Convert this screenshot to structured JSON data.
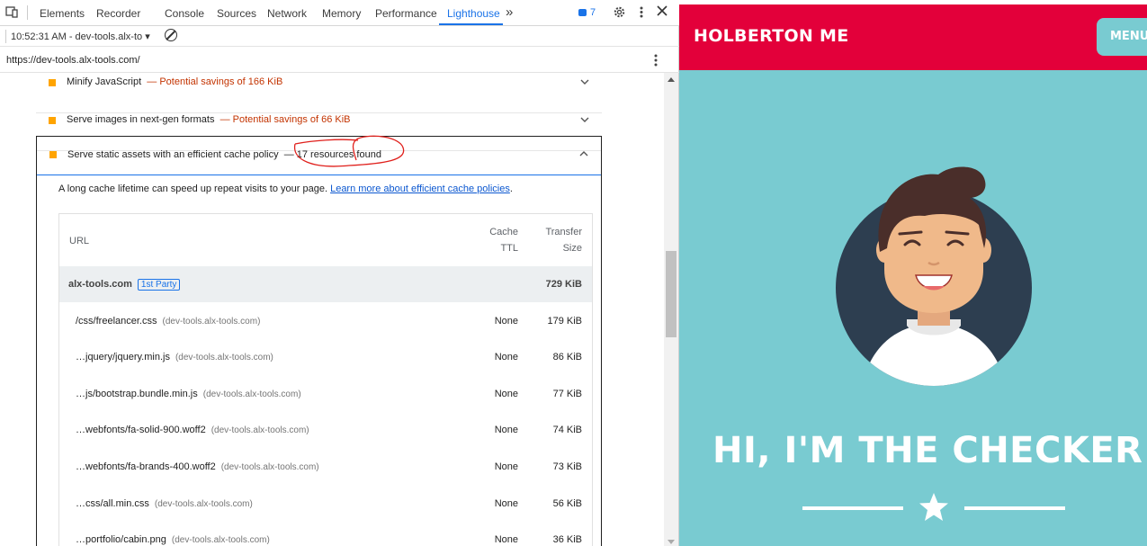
{
  "devtools": {
    "tabs": [
      "Elements",
      "Recorder",
      "Console",
      "Sources",
      "Network",
      "Memory",
      "Performance",
      "Lighthouse"
    ],
    "active_tab": "Lighthouse",
    "more_tabs": "»",
    "issues_count": "7",
    "report_selector": "10:52:31 AM - dev-tools.alx-to ▾",
    "page_url": "https://dev-tools.alx-tools.com/"
  },
  "audits": [
    {
      "title": "Minify JavaScript",
      "dash": "—",
      "detail": "Potential savings of 166 KiB"
    },
    {
      "title": "Serve images in next-gen formats",
      "dash": "—",
      "detail": "Potential savings of 66 KiB"
    }
  ],
  "expanded_audit": {
    "title": "Serve static assets with an efficient cache policy",
    "dash": "—",
    "detail": "17 resources found",
    "description": "A long cache lifetime can speed up repeat visits to your page.",
    "learn_more": "Learn more about efficient cache policies",
    "learn_more_suffix": ".",
    "table": {
      "col_url": "URL",
      "col_ttl_1": "Cache",
      "col_ttl_2": "TTL",
      "col_size_1": "Transfer",
      "col_size_2": "Size",
      "group": {
        "host": "alx-tools.com",
        "badge": "1st Party",
        "size": "729 KiB"
      },
      "rows": [
        {
          "url": "/css/freelancer.css",
          "host": "(dev-tools.alx-tools.com)",
          "ttl": "None",
          "size": "179 KiB"
        },
        {
          "url": "…jquery/jquery.min.js",
          "host": "(dev-tools.alx-tools.com)",
          "ttl": "None",
          "size": "86 KiB"
        },
        {
          "url": "…js/bootstrap.bundle.min.js",
          "host": "(dev-tools.alx-tools.com)",
          "ttl": "None",
          "size": "77 KiB"
        },
        {
          "url": "…webfonts/fa-solid-900.woff2",
          "host": "(dev-tools.alx-tools.com)",
          "ttl": "None",
          "size": "74 KiB"
        },
        {
          "url": "…webfonts/fa-brands-400.woff2",
          "host": "(dev-tools.alx-tools.com)",
          "ttl": "None",
          "size": "73 KiB"
        },
        {
          "url": "…css/all.min.css",
          "host": "(dev-tools.alx-tools.com)",
          "ttl": "None",
          "size": "56 KiB"
        },
        {
          "url": "…portfolio/cabin.png",
          "host": "(dev-tools.alx-tools.com)",
          "ttl": "None",
          "size": "36 KiB"
        }
      ]
    }
  },
  "site": {
    "brand": "HOLBERTON ME",
    "menu_label": "MENU",
    "hero_heading": "HI, I'M THE CHECKER!",
    "colors": {
      "nav": "#e3003a",
      "background": "#79cbd1"
    }
  }
}
